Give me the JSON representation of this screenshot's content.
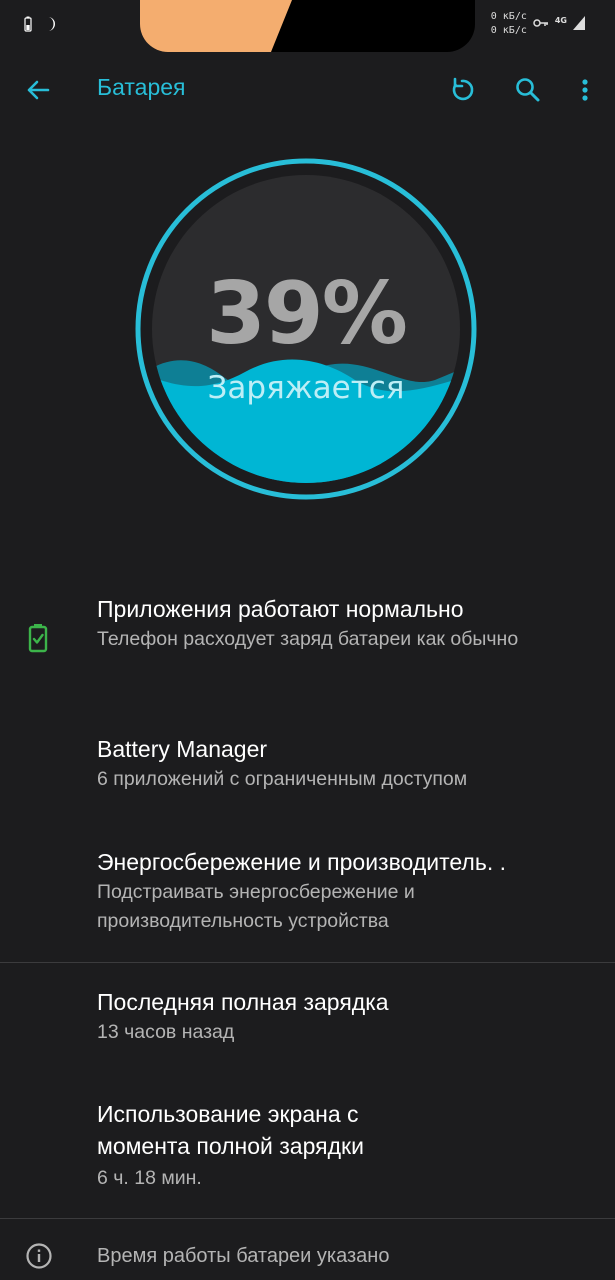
{
  "status_bar": {
    "speed_up": "0 кБ/с",
    "speed_down": "0 кБ/с",
    "network": "4G"
  },
  "app_bar": {
    "title": "Батарея"
  },
  "battery": {
    "percent_label": "39%",
    "level": 0.39,
    "status": "Заряжается"
  },
  "items": [
    {
      "title": "Приложения работают нормально",
      "subtitle": "Телефон расходует заряд батареи как обычно"
    },
    {
      "title": "Battery Manager",
      "subtitle": "6 приложений с ограниченным доступом"
    },
    {
      "title": "Энергосбережение и производитель. .",
      "subtitle": "Подстраивать энергосбережение и производительность устройства"
    },
    {
      "title": "Последняя полная зарядка",
      "subtitle": "13 часов назад"
    },
    {
      "title": "Использование экрана с момента полной зарядки",
      "subtitle": "6 ч. 18 мин."
    },
    {
      "title": "Время работы батареи указано"
    }
  ],
  "colors": {
    "background": "#1c1c1e",
    "accent": "#28bed8",
    "water": "#00b6d4",
    "status_ok": "#3cb44a"
  }
}
